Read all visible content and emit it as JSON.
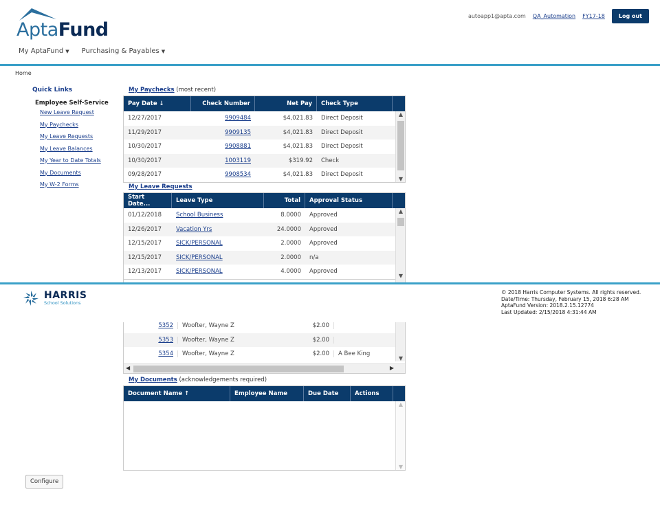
{
  "header": {
    "logo_apta": "Apta",
    "logo_fund": "Fund",
    "email": "autoapp1@apta.com",
    "user_link": "QA_Automation",
    "fy_link": "FY17-18",
    "logout": "Log out",
    "nav": [
      {
        "label": "My AptaFund"
      },
      {
        "label": "Purchasing & Payables"
      }
    ]
  },
  "breadcrumb": "Home",
  "quick_links": {
    "title": "Quick Links",
    "section": "Employee Self-Service",
    "items": [
      "New Leave Request",
      "My Paychecks",
      "My Leave Requests",
      "My Leave Balances",
      "My Year to Date Totals",
      "My Documents",
      "My W-2 Forms"
    ]
  },
  "paychecks": {
    "title": "My Paychecks",
    "suffix": " (most recent)",
    "columns": [
      "Pay Date ↓",
      "Check Number",
      "Net Pay",
      "Check Type"
    ],
    "rows": [
      [
        "12/27/2017",
        "9909484",
        "$4,021.83",
        "Direct Deposit"
      ],
      [
        "11/29/2017",
        "9909135",
        "$4,021.83",
        "Direct Deposit"
      ],
      [
        "10/30/2017",
        "9908881",
        "$4,021.83",
        "Direct Deposit"
      ],
      [
        "10/30/2017",
        "1003119",
        "$319.92",
        "Check"
      ],
      [
        "09/28/2017",
        "9908534",
        "$4,021.83",
        "Direct Deposit"
      ]
    ]
  },
  "leave_requests": {
    "title": "My Leave Requests",
    "columns": [
      "Start Date...",
      "Leave Type",
      "Total",
      "Approval Status"
    ],
    "rows": [
      [
        "01/12/2018",
        "School Business",
        "8.0000",
        "Approved"
      ],
      [
        "12/26/2017",
        "Vacation Yrs",
        "24.0000",
        "Approved"
      ],
      [
        "12/15/2017",
        "SICK/PERSONAL",
        "2.0000",
        "Approved"
      ],
      [
        "12/15/2017",
        "SICK/PERSONAL",
        "2.0000",
        "n/a"
      ],
      [
        "12/13/2017",
        "SICK/PERSONAL",
        "4.0000",
        "Approved"
      ]
    ]
  },
  "requisitions": {
    "rows": [
      [
        "5352",
        "Woofter, Wayne Z",
        "$2.00",
        ""
      ],
      [
        "5353",
        "Woofter, Wayne Z",
        "$2.00",
        ""
      ],
      [
        "5354",
        "Woofter, Wayne Z",
        "$2.00",
        "A Bee King"
      ]
    ]
  },
  "documents": {
    "title": "My Documents",
    "suffix": " (acknowledgements required)",
    "columns": [
      "Document Name ↑",
      "Employee Name",
      "Due Date",
      "Actions"
    ]
  },
  "footer": {
    "brand": "HARRIS",
    "brand_sub": "School Solutions",
    "lines": [
      "© 2018 Harris Computer Systems. All rights reserved.",
      "Date/Time: Thursday, February 15, 2018 6:28 AM",
      "AptaFund Version: 2018.2.15.12774",
      "Last Updated: 2/15/2018 4:31:44 AM"
    ]
  },
  "configure": "Configure",
  "colors": {
    "navy": "#0b3b6b",
    "accent": "#3aa0c8",
    "link": "#1a3e8c"
  }
}
